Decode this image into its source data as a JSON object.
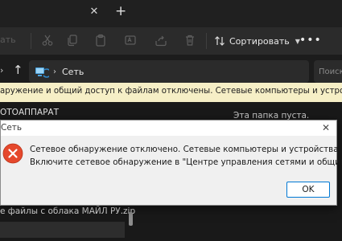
{
  "tabstrip": {
    "close_glyph": "✕",
    "new_tab_glyph": "+"
  },
  "toolbar": {
    "partial_label": "ать",
    "sort_label": "Сортировать",
    "more_label": "•••",
    "icons": [
      "cut-icon",
      "copy-icon",
      "paste-icon",
      "rename-icon",
      "share-icon",
      "delete-icon",
      "sort-icon"
    ]
  },
  "address": {
    "up_glyph": "↑",
    "location": "Сеть",
    "search_placeholder": "Поиск"
  },
  "infobar": {
    "text": "аружение и общий доступ к файлам отключены. Сетевые компьютеры и устройства не видны. Щелк"
  },
  "content": {
    "nav_item_top": "ОТОАППАРАТ",
    "empty_folder_text": "Эта папка пуста.",
    "nav_item_zip": "е файлы с облака МАЙЛ РУ.zip"
  },
  "dialog": {
    "title": "Сеть",
    "close_glyph": "✕",
    "message_line1": "Сетевое обнаружение отключено. Сетевые компьютеры и устройства не видны.",
    "message_line2": "Включите сетевое обнаружение в \"Центре управления сетями и общим доступом\".",
    "ok_label": "OK",
    "error_color": "#e81123"
  },
  "colors": {
    "accent": "#0078d4",
    "infobar_bg": "#f6efc6",
    "window_bg": "#1f1f1f"
  }
}
